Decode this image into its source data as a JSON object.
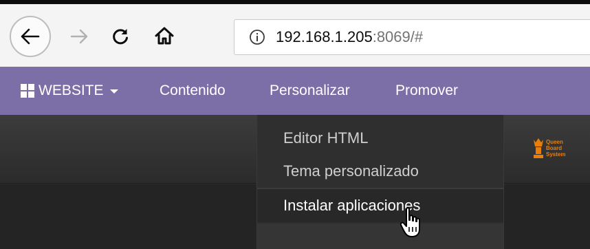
{
  "browser": {
    "url_host": "192.168.1.205",
    "url_rest": ":8069/#",
    "icons": [
      "back-icon",
      "forward-icon",
      "reload-icon",
      "home-icon",
      "info-icon"
    ]
  },
  "navbar": {
    "website_label": "WEBSITE",
    "items": [
      {
        "label": "Contenido"
      },
      {
        "label": "Personalizar"
      },
      {
        "label": "Promover"
      }
    ],
    "color": "#7c6fa8"
  },
  "dropdown": {
    "items": [
      {
        "label": "Editor HTML"
      },
      {
        "label": "Tema personalizado"
      },
      {
        "label": "Instalar aplicaciones",
        "hovered": true
      }
    ]
  },
  "logo": {
    "text_lines": [
      "Queen",
      "Board",
      "System"
    ],
    "color": "#e97f0a"
  }
}
